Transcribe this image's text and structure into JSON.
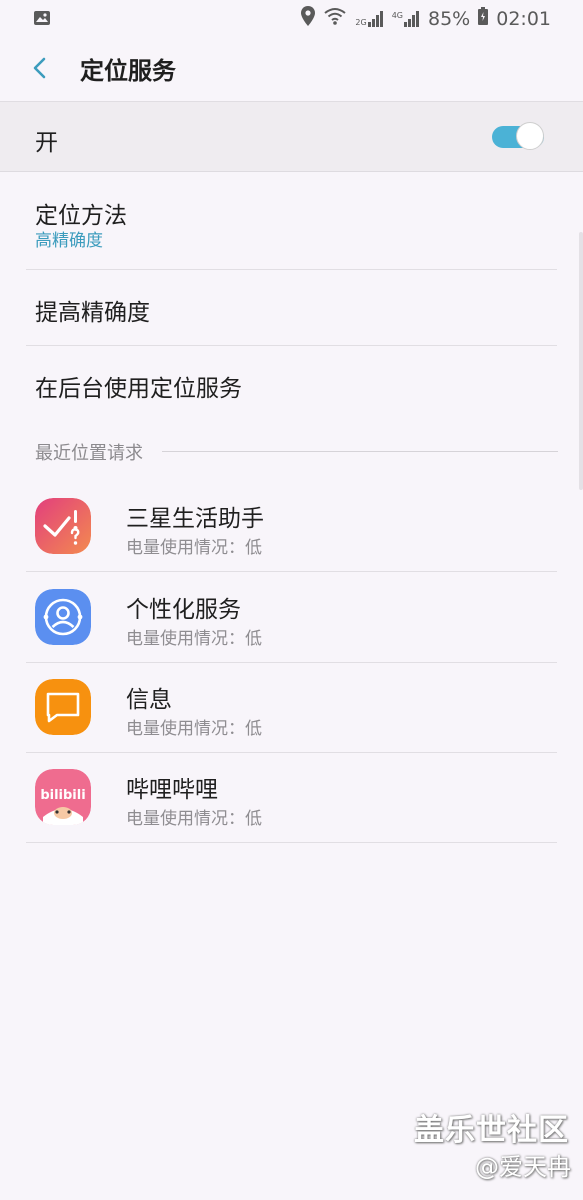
{
  "status_bar": {
    "battery": "85%",
    "time": "02:01",
    "net_2g": "2G",
    "net_4g": "4G"
  },
  "header": {
    "title": "定位服务"
  },
  "master_switch": {
    "label": "开",
    "state": "on"
  },
  "settings": [
    {
      "title": "定位方法",
      "subtitle": "高精确度"
    },
    {
      "title": "提高精确度"
    },
    {
      "title": "在后台使用定位服务"
    }
  ],
  "recent_section": {
    "title": "最近位置请求"
  },
  "apps": [
    {
      "name": "三星生活助手",
      "usage": "电量使用情况：低",
      "icon": "samsung-life-assistant-icon"
    },
    {
      "name": "个性化服务",
      "usage": "电量使用情况：低",
      "icon": "personalization-service-icon"
    },
    {
      "name": "信息",
      "usage": "电量使用情况：低",
      "icon": "messages-icon"
    },
    {
      "name": "哔哩哔哩",
      "usage": "电量使用情况：低",
      "icon": "bilibili-icon",
      "icon_text": "bilibili"
    }
  ],
  "watermark": {
    "site": "盖乐世社区",
    "author": "@爱天冉"
  },
  "colors": {
    "accent": "#4bb2d6",
    "link": "#3c9cbd",
    "background": "#f8f5fa"
  }
}
